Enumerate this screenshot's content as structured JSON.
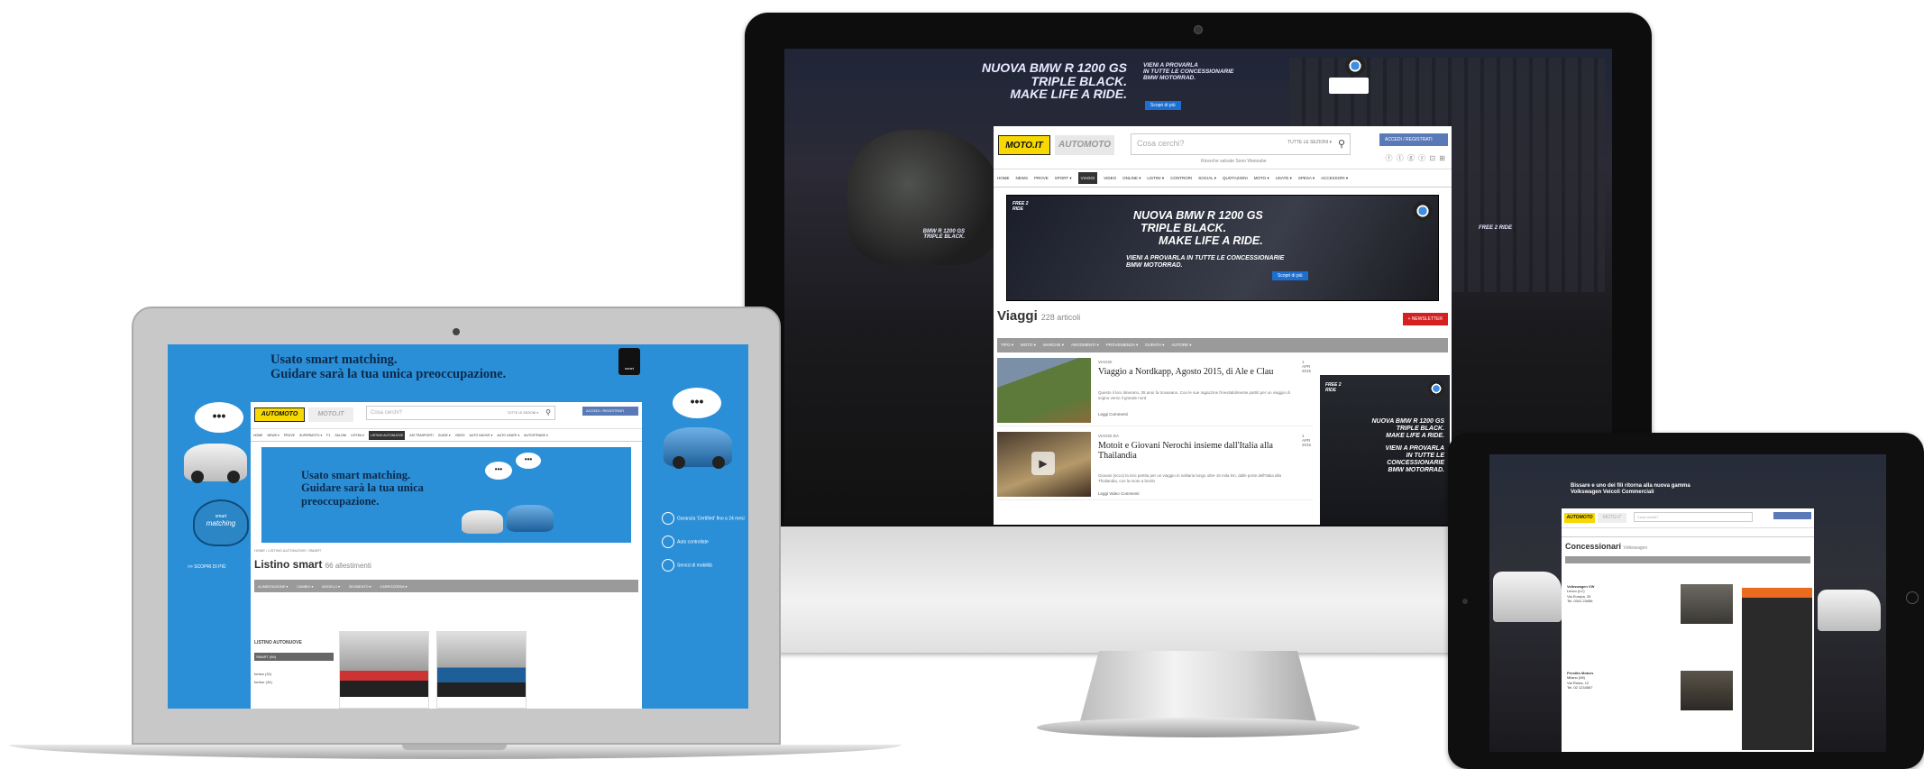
{
  "monitor": {
    "bg_ad": {
      "headline": [
        "NUOVA BMW R 1200 GS",
        "TRIPLE BLACK.",
        "MAKE LIFE A RIDE."
      ],
      "sub": [
        "VIENI A PROVARLA",
        "IN TUTTE LE CONCESSIONARIE",
        "BMW MOTORRAD."
      ],
      "cta": "Scopri di più",
      "left_caption": [
        "BMW R 1200 GS",
        "TRIPLE BLACK."
      ],
      "right_caption": "FREE 2 RIDE"
    },
    "header": {
      "logo_moto": "MOTO.IT",
      "logo_auto": "AUTOMOTO",
      "search_placeholder": "Cosa cerchi?",
      "search_filter": "TUTTE LE SEZIONI ▾",
      "login": "ACCEDI / REGISTRATI",
      "sub_links": "Ricerche salvate   Sono Wannabe",
      "icons": "ⓕ ⓣ ⓖ ⓨ  ⊡ ⊞"
    },
    "nav": [
      "HOME",
      "NEWS",
      "PROVE",
      "SPORT ▾",
      "VIAGGI",
      "VIDEO",
      "ONLINE ▾",
      "LISTINI ▾",
      "CONTRORI",
      "SOCIAL ▾",
      "QUOTAZIONI",
      "MOTO ▾",
      "USATE ▾",
      "SPESA ▾",
      "ACCESSORI ▾"
    ],
    "nav_active_index": 4,
    "ad": {
      "headline": [
        "NUOVA BMW R 1200 GS",
        "TRIPLE BLACK.",
        "MAKE LIFE A RIDE."
      ],
      "sub": [
        "VIENI A PROVARLA IN TUTTE LE CONCESSIONARIE",
        "BMW MOTORRAD."
      ],
      "cta": "Scopri di più",
      "badge": "FREE 2 RIDE"
    },
    "section": {
      "title": "Viaggi",
      "count": "228 articoli",
      "new_button": "+ NEWSLETTER"
    },
    "filters": [
      "TIPO ▾",
      "MOTO ▾",
      "MARCHE ▾",
      "ARGOMENTI ▾",
      "PROVENIENZA ▾",
      "DURATA ▾",
      "AUTORE ▾"
    ],
    "articles": [
      {
        "kicker": "VIAGGI",
        "date": "1 APR 2015",
        "title": "Viaggio a Nordkapp, Agosto 2015, di Ale e Clau",
        "excerpt": "Questo il loro itinerario, 35 anni fa trovavano. Con le sue ragazzine l'inevitabilmente partiti per un viaggio di sogno verso il grande nord",
        "meta": "Leggi   Commenti"
      },
      {
        "kicker": "VIAGGI DA",
        "date": "1 APR 2015",
        "title": "Motoit e Giovani Nerochi insieme dall'Italia alla Thailandia",
        "excerpt": "Giovani (ecco) la loro partita per un viaggio in solitaria lungo oltre 16 mila km, dalle porte dell'Italia alla Thailandia, con la moto a bordo",
        "meta": "Leggi   Video   Commenti"
      }
    ],
    "side_ad": [
      "NUOVA BMW R 1200 GS",
      "TRIPLE BLACK.",
      "MAKE LIFE A RIDE.",
      "VIENI A PROVARLA",
      "IN TUTTE LE",
      "CONCESSIONARIE",
      "BMW MOTORRAD."
    ]
  },
  "laptop": {
    "headline": [
      "Usato smart matching.",
      "Guidare sarà la tua unica preoccupazione."
    ],
    "brand_badge": "smart",
    "bubble_text": "•••",
    "heart_text": [
      "smart",
      "matching"
    ],
    "side_link": ">> SCOPRI DI PIÙ",
    "features": [
      "Garanzia 'Certified' fino a 24 mesi",
      "Auto controllate",
      "Servizi di mobilità"
    ],
    "header": {
      "logo_auto": "AUTOMOTO",
      "logo_moto": "MOTO.IT",
      "search_placeholder": "Cosa cerchi?",
      "search_filter": "TUTTE LE SEZIONI ▾",
      "login": "ACCEDI / REGISTRATI"
    },
    "nav": [
      "HOME",
      "NEWS ▾",
      "PROVE",
      "SUPERMOTO ▾",
      "F1",
      "SALONI",
      "LISTINI ▾",
      "LISTINO AUTONUOVE",
      "ASI TRASPORTI",
      "GUIDE ▾",
      "VIDEO",
      "AUTO NUOVE ▾",
      "AUTO USATE ▾",
      "AUTOSTRADE ▾"
    ],
    "nav_active_index": 7,
    "banner_headline": [
      "Usato smart matching.",
      "Guidare sarà la tua unica",
      "preoccupazione."
    ],
    "breadcrumb": "HOME / LISTINO AUTONUOVE / SMART",
    "title": "Listino smart",
    "count": "66 allestimenti",
    "filters": [
      "ALIMENTAZIONE ▾",
      "CAMBIO ▾",
      "MODELLI ▾",
      "SEGMENTO ▾",
      "CARROZZERIA ▾"
    ],
    "list_heading": "LISTINO AUTONUOVE",
    "list_sub": "SMART (66)",
    "list_items": [
      "fortwo (32)",
      "forfour (34)"
    ]
  },
  "tablet": {
    "ad_text": [
      "Bissare e uno dei fili ritorna alla nuova gamma",
      "Volkswagen Veicoli Commerciali"
    ],
    "header": {
      "logo_auto": "AUTOMOTO",
      "logo_moto": "MOTO.IT",
      "search_placeholder": "Cosa cerchi?"
    },
    "title": "Concessionari",
    "count": "Volkswagen",
    "dealers": [
      {
        "name": "Volkswagen VW",
        "lines": [
          "Lecco (LC)",
          "Via Europa, 33",
          "Tel. 0341 23456"
        ]
      },
      {
        "name": "Prestito Motors",
        "lines": [
          "Milano (MI)",
          "Via Roma, 12",
          "Tel. 02 1234567"
        ]
      }
    ]
  },
  "colors": {
    "moto_yellow": "#f7d800",
    "smart_blue": "#2b8fd8",
    "login_blue": "#5a79b7",
    "accent_red": "#d62020"
  }
}
